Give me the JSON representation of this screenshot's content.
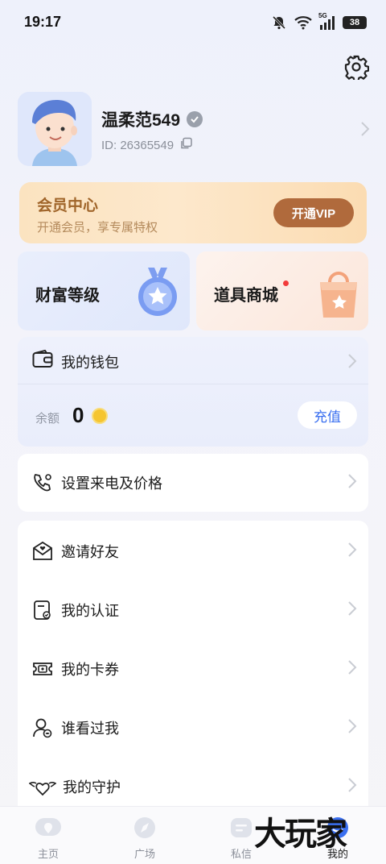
{
  "status": {
    "time": "19:17",
    "battery": "38",
    "network": "5G"
  },
  "profile": {
    "nickname": "温柔范549",
    "id": "ID: 26365549"
  },
  "vip": {
    "title": "会员中心",
    "subtitle": "开通会员，享专属特权",
    "button": "开通VIP"
  },
  "tiles": {
    "wealth": "财富等级",
    "shop": "道具商城"
  },
  "wallet": {
    "title": "我的钱包",
    "balance_label": "余额",
    "balance": "0",
    "recharge": "充值"
  },
  "call_settings": {
    "label": "设置来电及价格"
  },
  "menu": [
    {
      "label": "邀请好友",
      "icon": "invite-icon"
    },
    {
      "label": "我的认证",
      "icon": "certificate-icon"
    },
    {
      "label": "我的卡券",
      "icon": "ticket-icon"
    },
    {
      "label": "谁看过我",
      "icon": "visitor-icon"
    },
    {
      "label": "我的守护",
      "icon": "guard-heart-icon"
    }
  ],
  "nav": [
    {
      "label": "主页",
      "icon": "home-icon"
    },
    {
      "label": "广场",
      "icon": "compass-icon"
    },
    {
      "label": "私信",
      "icon": "message-icon"
    },
    {
      "label": "我的",
      "icon": "me-icon"
    }
  ],
  "watermark": "大玩家",
  "colors": {
    "accent": "#3a6ff0",
    "vip_button": "#b06a3c",
    "vip_title": "#a0652a"
  }
}
